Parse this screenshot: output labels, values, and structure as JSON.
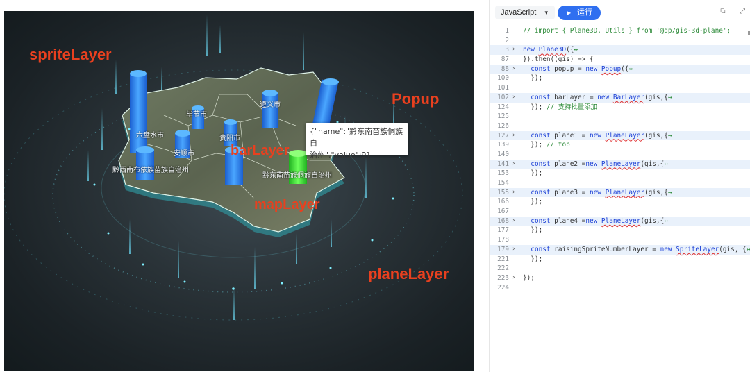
{
  "map": {
    "labels": {
      "sprite": "spriteLayer",
      "popup": "Popup",
      "bar": "barLayer",
      "map": "mapLayer",
      "plane": "planeLayer"
    },
    "cities": {
      "bijie": "毕节市",
      "zunyi": "遵义市",
      "liupanshui": "六盘水市",
      "guiyang": "贵阳市",
      "anshun": "安顺市",
      "qianxinan": "黔西南布依族苗族自治州",
      "qiandongnan": "黔东南苗族侗族自治州"
    },
    "popup": {
      "line1": "{\"name\":\"黔东南苗族侗族自",
      "line2": "治州\",\"value\":9}"
    },
    "colors": {
      "bar": "#2f8cff",
      "bar_highlight": "#3ef03a",
      "label": "#e8401f"
    }
  },
  "editor": {
    "language": "JavaScript",
    "run_label": "运行",
    "lines": [
      {
        "n": "1",
        "fold": "",
        "hl": false,
        "parts": [
          [
            "c",
            "// import { Plane3D, Utils } from '@dp/gis-3d-plane';"
          ]
        ]
      },
      {
        "n": "2",
        "fold": "",
        "hl": false,
        "parts": []
      },
      {
        "n": "3",
        "fold": "›",
        "hl": true,
        "parts": [
          [
            "k",
            "new "
          ],
          [
            "f",
            "Plane3D"
          ],
          [
            "d",
            "({"
          ],
          [
            "c",
            "↔"
          ]
        ]
      },
      {
        "n": "87",
        "fold": "",
        "hl": false,
        "parts": [
          [
            "d",
            "}).then((gis) => {"
          ]
        ]
      },
      {
        "n": "88",
        "fold": "›",
        "hl": true,
        "parts": [
          [
            "d",
            "  "
          ],
          [
            "k",
            "const "
          ],
          [
            "d",
            "popup = "
          ],
          [
            "k",
            "new "
          ],
          [
            "f",
            "Popup"
          ],
          [
            "d",
            "({"
          ],
          [
            "c",
            "↔"
          ]
        ]
      },
      {
        "n": "100",
        "fold": "",
        "hl": false,
        "parts": [
          [
            "d",
            "  });"
          ]
        ]
      },
      {
        "n": "101",
        "fold": "",
        "hl": false,
        "parts": []
      },
      {
        "n": "102",
        "fold": "›",
        "hl": true,
        "parts": [
          [
            "d",
            "  "
          ],
          [
            "k",
            "const "
          ],
          [
            "d",
            "barLayer = "
          ],
          [
            "k",
            "new "
          ],
          [
            "f",
            "BarLayer"
          ],
          [
            "d",
            "(gis,{"
          ],
          [
            "c",
            "↔"
          ]
        ]
      },
      {
        "n": "124",
        "fold": "",
        "hl": false,
        "parts": [
          [
            "d",
            "  }); "
          ],
          [
            "c",
            "// 支持批量添加"
          ]
        ]
      },
      {
        "n": "125",
        "fold": "",
        "hl": false,
        "parts": []
      },
      {
        "n": "126",
        "fold": "",
        "hl": false,
        "parts": []
      },
      {
        "n": "127",
        "fold": "›",
        "hl": true,
        "parts": [
          [
            "d",
            "  "
          ],
          [
            "k",
            "const "
          ],
          [
            "d",
            "plane1 = "
          ],
          [
            "k",
            "new "
          ],
          [
            "f",
            "PlaneLayer"
          ],
          [
            "d",
            "(gis,{"
          ],
          [
            "c",
            "↔"
          ]
        ]
      },
      {
        "n": "139",
        "fold": "",
        "hl": false,
        "parts": [
          [
            "d",
            "  }); "
          ],
          [
            "c",
            "// top"
          ]
        ]
      },
      {
        "n": "140",
        "fold": "",
        "hl": false,
        "parts": []
      },
      {
        "n": "141",
        "fold": "›",
        "hl": true,
        "parts": [
          [
            "d",
            "  "
          ],
          [
            "k",
            "const "
          ],
          [
            "d",
            "plane2 ="
          ],
          [
            "k",
            "new "
          ],
          [
            "f",
            "PlaneLayer"
          ],
          [
            "d",
            "(gis,{"
          ],
          [
            "c",
            "↔"
          ]
        ]
      },
      {
        "n": "153",
        "fold": "",
        "hl": false,
        "parts": [
          [
            "d",
            "  });"
          ]
        ]
      },
      {
        "n": "154",
        "fold": "",
        "hl": false,
        "parts": []
      },
      {
        "n": "155",
        "fold": "›",
        "hl": true,
        "parts": [
          [
            "d",
            "  "
          ],
          [
            "k",
            "const "
          ],
          [
            "d",
            "plane3 = "
          ],
          [
            "k",
            "new "
          ],
          [
            "f",
            "PlaneLayer"
          ],
          [
            "d",
            "(gis,{"
          ],
          [
            "c",
            "↔"
          ]
        ]
      },
      {
        "n": "166",
        "fold": "",
        "hl": false,
        "parts": [
          [
            "d",
            "  });"
          ]
        ]
      },
      {
        "n": "167",
        "fold": "",
        "hl": false,
        "parts": []
      },
      {
        "n": "168",
        "fold": "›",
        "hl": true,
        "parts": [
          [
            "d",
            "  "
          ],
          [
            "k",
            "const "
          ],
          [
            "d",
            "plane4 ="
          ],
          [
            "k",
            "new "
          ],
          [
            "f",
            "PlaneLayer"
          ],
          [
            "d",
            "(gis,{"
          ],
          [
            "c",
            "↔"
          ]
        ]
      },
      {
        "n": "177",
        "fold": "",
        "hl": false,
        "parts": [
          [
            "d",
            "  });"
          ]
        ]
      },
      {
        "n": "178",
        "fold": "",
        "hl": false,
        "parts": []
      },
      {
        "n": "179",
        "fold": "›",
        "hl": true,
        "parts": [
          [
            "d",
            "  "
          ],
          [
            "k",
            "const "
          ],
          [
            "d",
            "raisingSpriteNumberLayer = "
          ],
          [
            "k",
            "new "
          ],
          [
            "f",
            "SpriteLayer"
          ],
          [
            "d",
            "(gis, {"
          ],
          [
            "c",
            "↔"
          ]
        ]
      },
      {
        "n": "221",
        "fold": "",
        "hl": false,
        "parts": [
          [
            "d",
            "  });"
          ]
        ]
      },
      {
        "n": "222",
        "fold": "",
        "hl": false,
        "parts": []
      },
      {
        "n": "223",
        "fold": "›",
        "hl": false,
        "parts": [
          [
            "d",
            "});"
          ]
        ]
      },
      {
        "n": "224",
        "fold": "",
        "hl": false,
        "parts": []
      }
    ]
  }
}
